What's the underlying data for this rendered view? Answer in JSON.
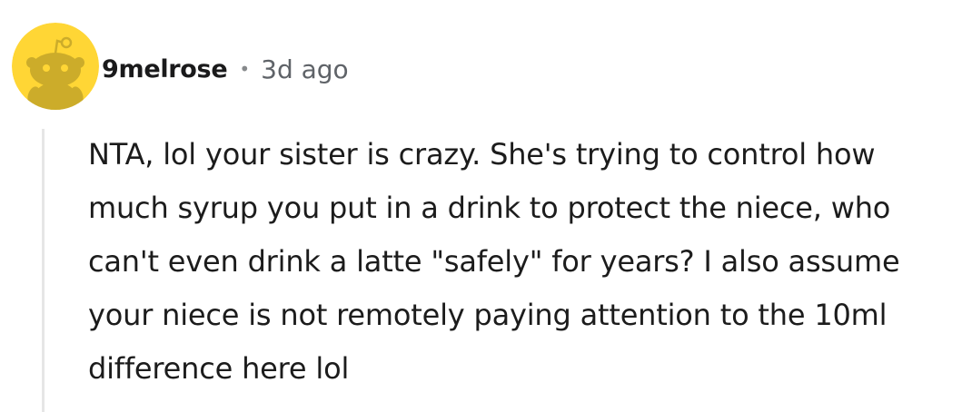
{
  "comment": {
    "author": "9melrose",
    "separator": "•",
    "time_ago": "3d ago",
    "avatar_icon": "snoo-avatar-icon",
    "avatar_color": "#ffd635",
    "body": "NTA, lol your sister is crazy. She's trying to control how much syrup you put in a drink to protect the niece, who can't even drink a latte \"safely\" for years? I also assume your niece is not remotely paying attention to the 10ml difference here lol"
  }
}
